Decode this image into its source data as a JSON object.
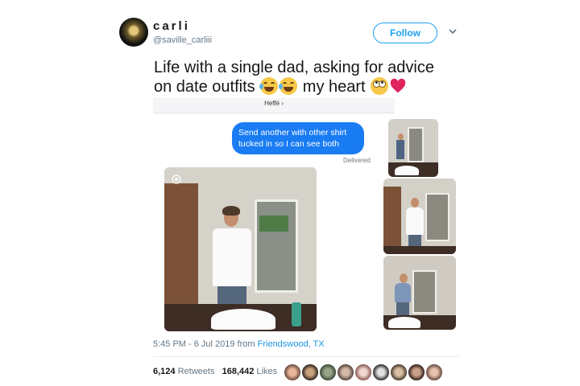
{
  "user": {
    "display_name": "carli",
    "handle": "@saville_carliii",
    "follow_label": "Follow"
  },
  "tweet": {
    "text_line1": "Life with a single dad, asking for advice",
    "text_line2_a": "on date outfits",
    "text_line2_b": "my heart",
    "emojis": [
      "tears-of-joy-icon",
      "tears-of-joy-icon",
      "eye-roll-icon",
      "red-heart-icon"
    ]
  },
  "media": {
    "contact_name": "Heffé ›",
    "message": "Send another with other shirt tucked in so I can see both",
    "delivered": "Delivered"
  },
  "meta": {
    "time_date": "5:45 PM - 6 Jul 2019 from ",
    "location": "Friendswood, TX"
  },
  "stats": {
    "retweets_count": "6,124",
    "retweets_label": "Retweets",
    "likes_count": "168,442",
    "likes_label": "Likes"
  },
  "colors": {
    "accent": "#1da1f2",
    "imessage_blue": "#1a7cf3",
    "heart": "#e0245e"
  }
}
